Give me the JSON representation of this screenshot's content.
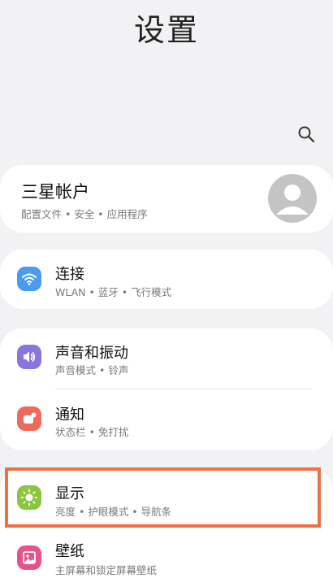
{
  "header": {
    "title": "设置"
  },
  "account": {
    "label": "三星帐户",
    "sub": "配置文件 • 安全 • 应用程序"
  },
  "items": [
    {
      "label": "连接",
      "sub": "WLAN • 蓝牙 • 飞行模式",
      "color": "#4a9af0",
      "icon": "wifi-icon"
    },
    {
      "label": "声音和振动",
      "sub": "声音模式 • 铃声",
      "color": "#8a75e0",
      "icon": "volume-icon"
    },
    {
      "label": "通知",
      "sub": "状态栏 • 免打扰",
      "color": "#ee6a5a",
      "icon": "notification-icon"
    },
    {
      "label": "显示",
      "sub": "亮度 • 护眼模式 • 导航条",
      "color": "#8cc63f",
      "icon": "sun-icon"
    },
    {
      "label": "壁纸",
      "sub": "主屏幕和锁定屏幕壁纸",
      "color": "#e8528a",
      "icon": "image-icon"
    }
  ],
  "colors": {
    "highlight": "#f07040",
    "background": "#f2f2f4",
    "card": "#ffffff"
  }
}
